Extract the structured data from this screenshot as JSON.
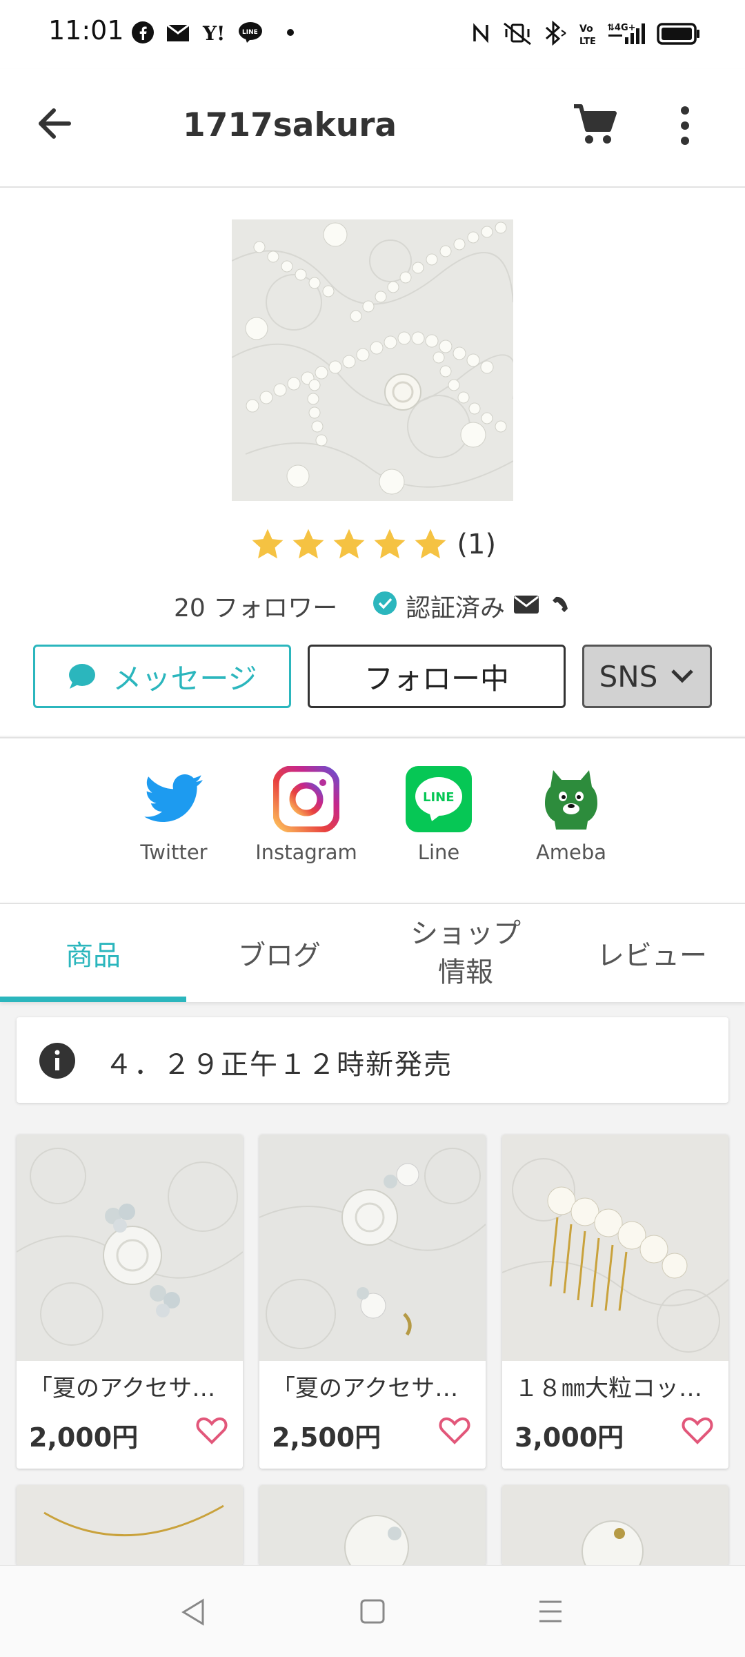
{
  "status": {
    "time": "11:01",
    "right_icons": [
      "nfc-icon",
      "mute-vibrate-icon",
      "bluetooth-icon",
      "volte-icon",
      "signal-4g-icon",
      "battery-icon"
    ],
    "left_icons": [
      "facebook-icon",
      "mail-app-icon",
      "yahoo-icon",
      "line-icon",
      "dot-icon"
    ]
  },
  "header": {
    "title": "1717sakura"
  },
  "profile": {
    "rating_stars": 5,
    "rating_count": "(1)",
    "followers": "20 フォロワー",
    "verified": "認証済み",
    "message_label": "メッセージ",
    "follow_label": "フォロー中",
    "sns_label": "SNS"
  },
  "sns_links": [
    {
      "label": "Twitter"
    },
    {
      "label": "Instagram"
    },
    {
      "label": "Line"
    },
    {
      "label": "Ameba"
    }
  ],
  "tabs": [
    {
      "label": "商品"
    },
    {
      "label": "ブログ"
    },
    {
      "label": "ショップ情報"
    },
    {
      "label": "レビュー"
    }
  ],
  "notice": {
    "text": "４．２９正午１２時新発売"
  },
  "products": [
    {
      "name": "「夏のアクセサ…",
      "price": "2,000円"
    },
    {
      "name": "「夏のアクセサ…",
      "price": "2,500円"
    },
    {
      "name": "１８㎜大粒コッ…",
      "price": "3,000円"
    }
  ],
  "colors": {
    "accent": "#2bb6bd",
    "star": "#f5c242",
    "heart": "#e2577a"
  }
}
